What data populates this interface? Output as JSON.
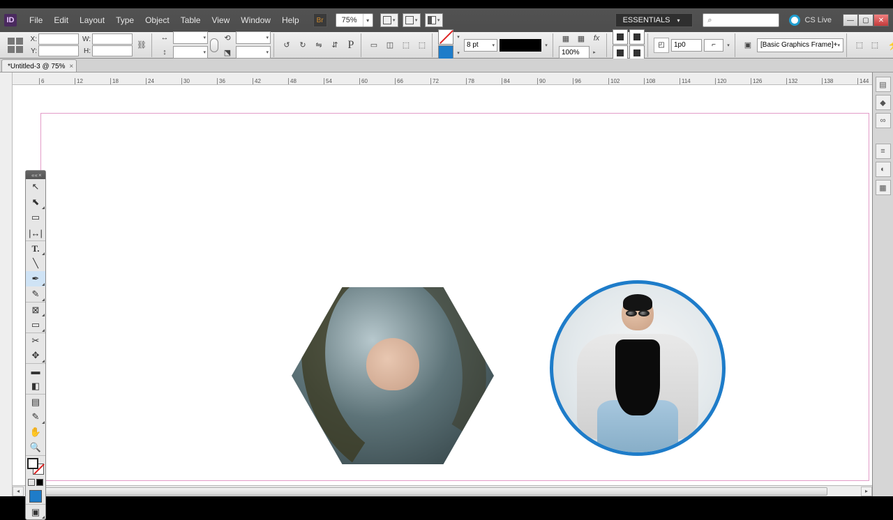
{
  "menu": {
    "file": "File",
    "edit": "Edit",
    "layout": "Layout",
    "type": "Type",
    "object": "Object",
    "table": "Table",
    "view": "View",
    "window": "Window",
    "help": "Help"
  },
  "titlebar": {
    "zoom": "75%",
    "workspace": "ESSENTIALS",
    "cslive": "CS Live",
    "search_placeholder": ""
  },
  "control": {
    "x": "",
    "y": "",
    "w": "",
    "h": "",
    "rotate": "",
    "shearx": "",
    "sheary": "",
    "stroke_weight": "8 pt",
    "percent": "100%",
    "gap": "1p0",
    "style": "[Basic Graphics Frame]+"
  },
  "doc": {
    "tab": "*Untitled-3 @ 75%"
  },
  "ruler": {
    "ticks": [
      "6",
      "12",
      "18",
      "24",
      "30",
      "36",
      "42",
      "48",
      "54",
      "60",
      "66",
      "72",
      "78",
      "84",
      "90",
      "96",
      "102",
      "108",
      "114",
      "120",
      "126",
      "132",
      "138",
      "144"
    ]
  },
  "tools": {
    "selection": "selection-tool",
    "direct": "direct-selection-tool",
    "page": "page-tool",
    "gap": "gap-tool",
    "type": "type-tool",
    "line": "line-tool",
    "pen": "pen-tool",
    "pencil": "pencil-tool",
    "rectframe": "rectangle-frame-tool",
    "rect": "rectangle-tool",
    "scissors": "scissors-tool",
    "freetrans": "free-transform-tool",
    "gradswatch": "gradient-swatch-tool",
    "gradfeather": "gradient-feather-tool",
    "note": "note-tool",
    "eyedrop": "eyedropper-tool",
    "hand": "hand-tool",
    "zoom": "zoom-tool"
  }
}
